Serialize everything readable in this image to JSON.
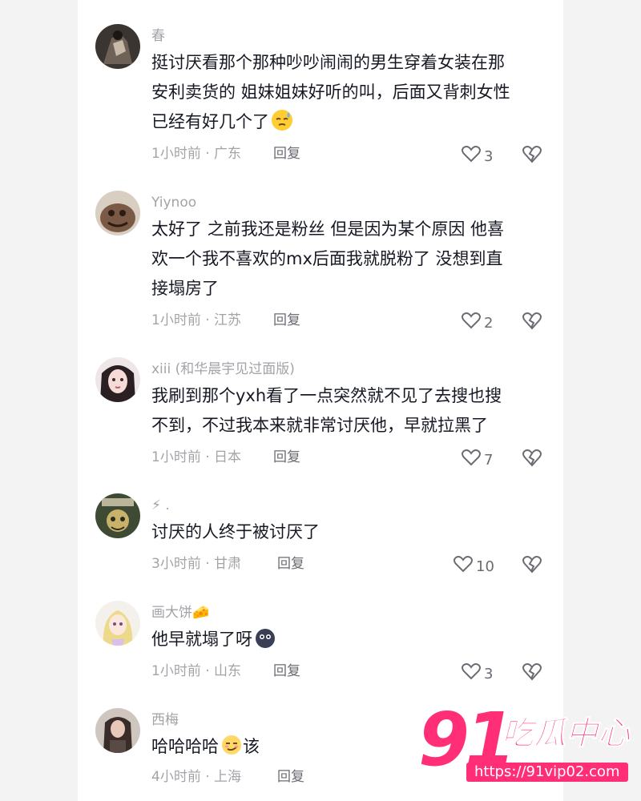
{
  "comments": [
    {
      "username": "春",
      "text_lines": [
        "挺讨厌看那个那种吵吵闹闹的男生穿着女装在那",
        "安利卖货的 姐妹姐妹好听的叫，后面又背刺女性",
        "已经有好几个了"
      ],
      "emoji": "sleepy-sweat-emoji",
      "time_location": "1小时前 · 广东",
      "reply_label": "回复",
      "likes": "3"
    },
    {
      "username": "Yiynoo",
      "text_lines": [
        "太好了 之前我还是粉丝 但是因为某个原因 他喜",
        "欢一个我不喜欢的mx后面我就脱粉了 没想到直",
        "接塌房了"
      ],
      "time_location": "1小时前 · 江苏",
      "reply_label": "回复",
      "likes": "2"
    },
    {
      "username": "xiii (和华晨宇见过面版)",
      "text_lines": [
        "我刷到那个yxh看了一点突然就不见了去搜也搜",
        "不到，不过我本来就非常讨厌他，早就拉黑了"
      ],
      "time_location": "1小时前 · 日本",
      "reply_label": "回复",
      "likes": "7"
    },
    {
      "username": "⚡ .",
      "text_lines": [
        "讨厌的人终于被讨厌了"
      ],
      "time_location": "3小时前 · 甘肃",
      "reply_label": "回复",
      "likes": "10"
    },
    {
      "username": "画大饼🧀",
      "text_lines": [
        "他早就塌了呀"
      ],
      "emoji": "dark-blob-emoji",
      "time_location": "1小时前 · 山东",
      "reply_label": "回复",
      "likes": "3"
    },
    {
      "username": "西梅",
      "text_lines": [
        "哈哈哈哈",
        "该"
      ],
      "emoji": "smirk-emoji",
      "time_location": "4小时前 · 上海",
      "reply_label": "回复",
      "likes": ""
    }
  ],
  "watermark": {
    "number": "91",
    "brand": "吃瓜中心",
    "url": "https://91vip02.com"
  },
  "colors": {
    "accent": "#ff2e77",
    "text": "#161823",
    "muted": "#a3a3a8"
  }
}
